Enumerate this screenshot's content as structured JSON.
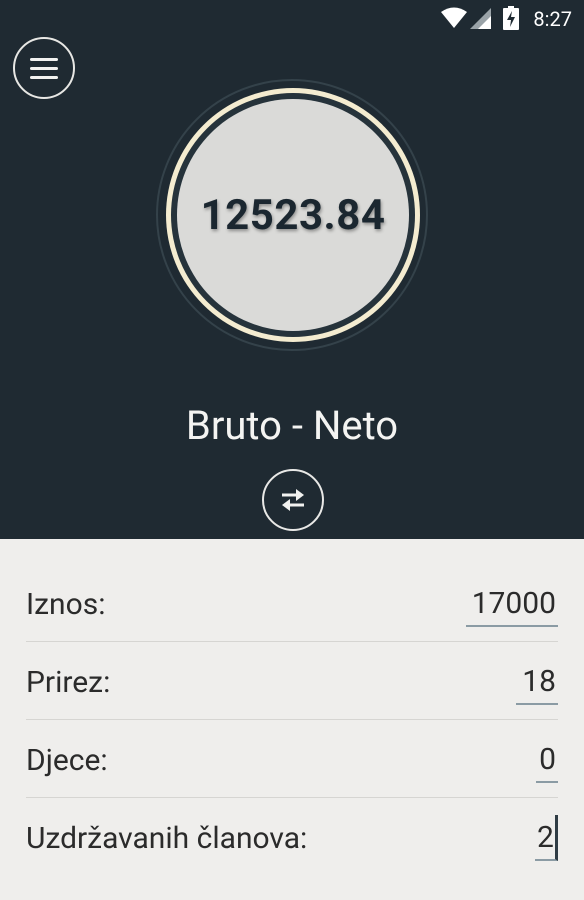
{
  "status_bar": {
    "time": "8:27",
    "icons": [
      "wifi-icon",
      "signal-icon",
      "battery-charging-icon"
    ]
  },
  "header": {
    "menu_icon": "hamburger-menu-icon",
    "result": "12523.84",
    "title": "Bruto - Neto",
    "swap_icon": "swap-arrows-icon"
  },
  "form": {
    "fields": [
      {
        "label": "Iznos:",
        "value": "17000"
      },
      {
        "label": "Prirez:",
        "value": "18"
      },
      {
        "label": "Djece:",
        "value": "0"
      },
      {
        "label": "Uzdržavanih članova:",
        "value": "2"
      }
    ]
  },
  "colors": {
    "header_bg": "#1f2a32",
    "form_bg": "#efeeec",
    "ring_accent": "#f4ecd0",
    "result_face": "#dadad8",
    "field_underline": "#8b9ba4"
  }
}
